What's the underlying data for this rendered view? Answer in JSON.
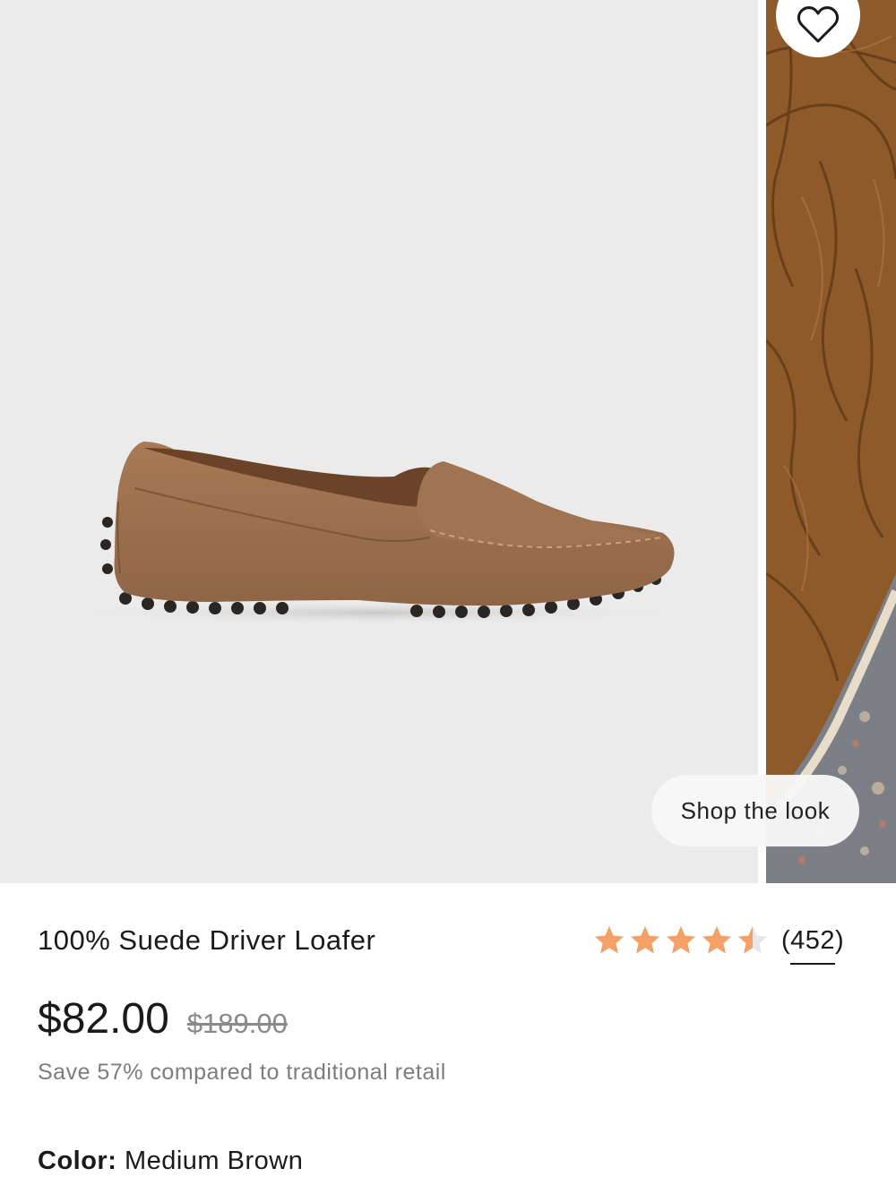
{
  "product": {
    "title": "100% Suede Driver Loafer",
    "rating": 4.5,
    "review_count": "(452)",
    "price": "$82.00",
    "original_price": "$189.00",
    "savings_text": "Save 57% compared to traditional retail",
    "color_label": "Color:",
    "color_value": "Medium Brown"
  },
  "gallery": {
    "shop_the_look_label": "Shop the look"
  },
  "icons": {
    "favorite": "heart-icon",
    "rating": "star-icon"
  },
  "colors": {
    "star": "#f4a067",
    "star_empty": "#e6e6e6",
    "image_background": "#ebebeb",
    "suede": "#9a6e4c"
  }
}
